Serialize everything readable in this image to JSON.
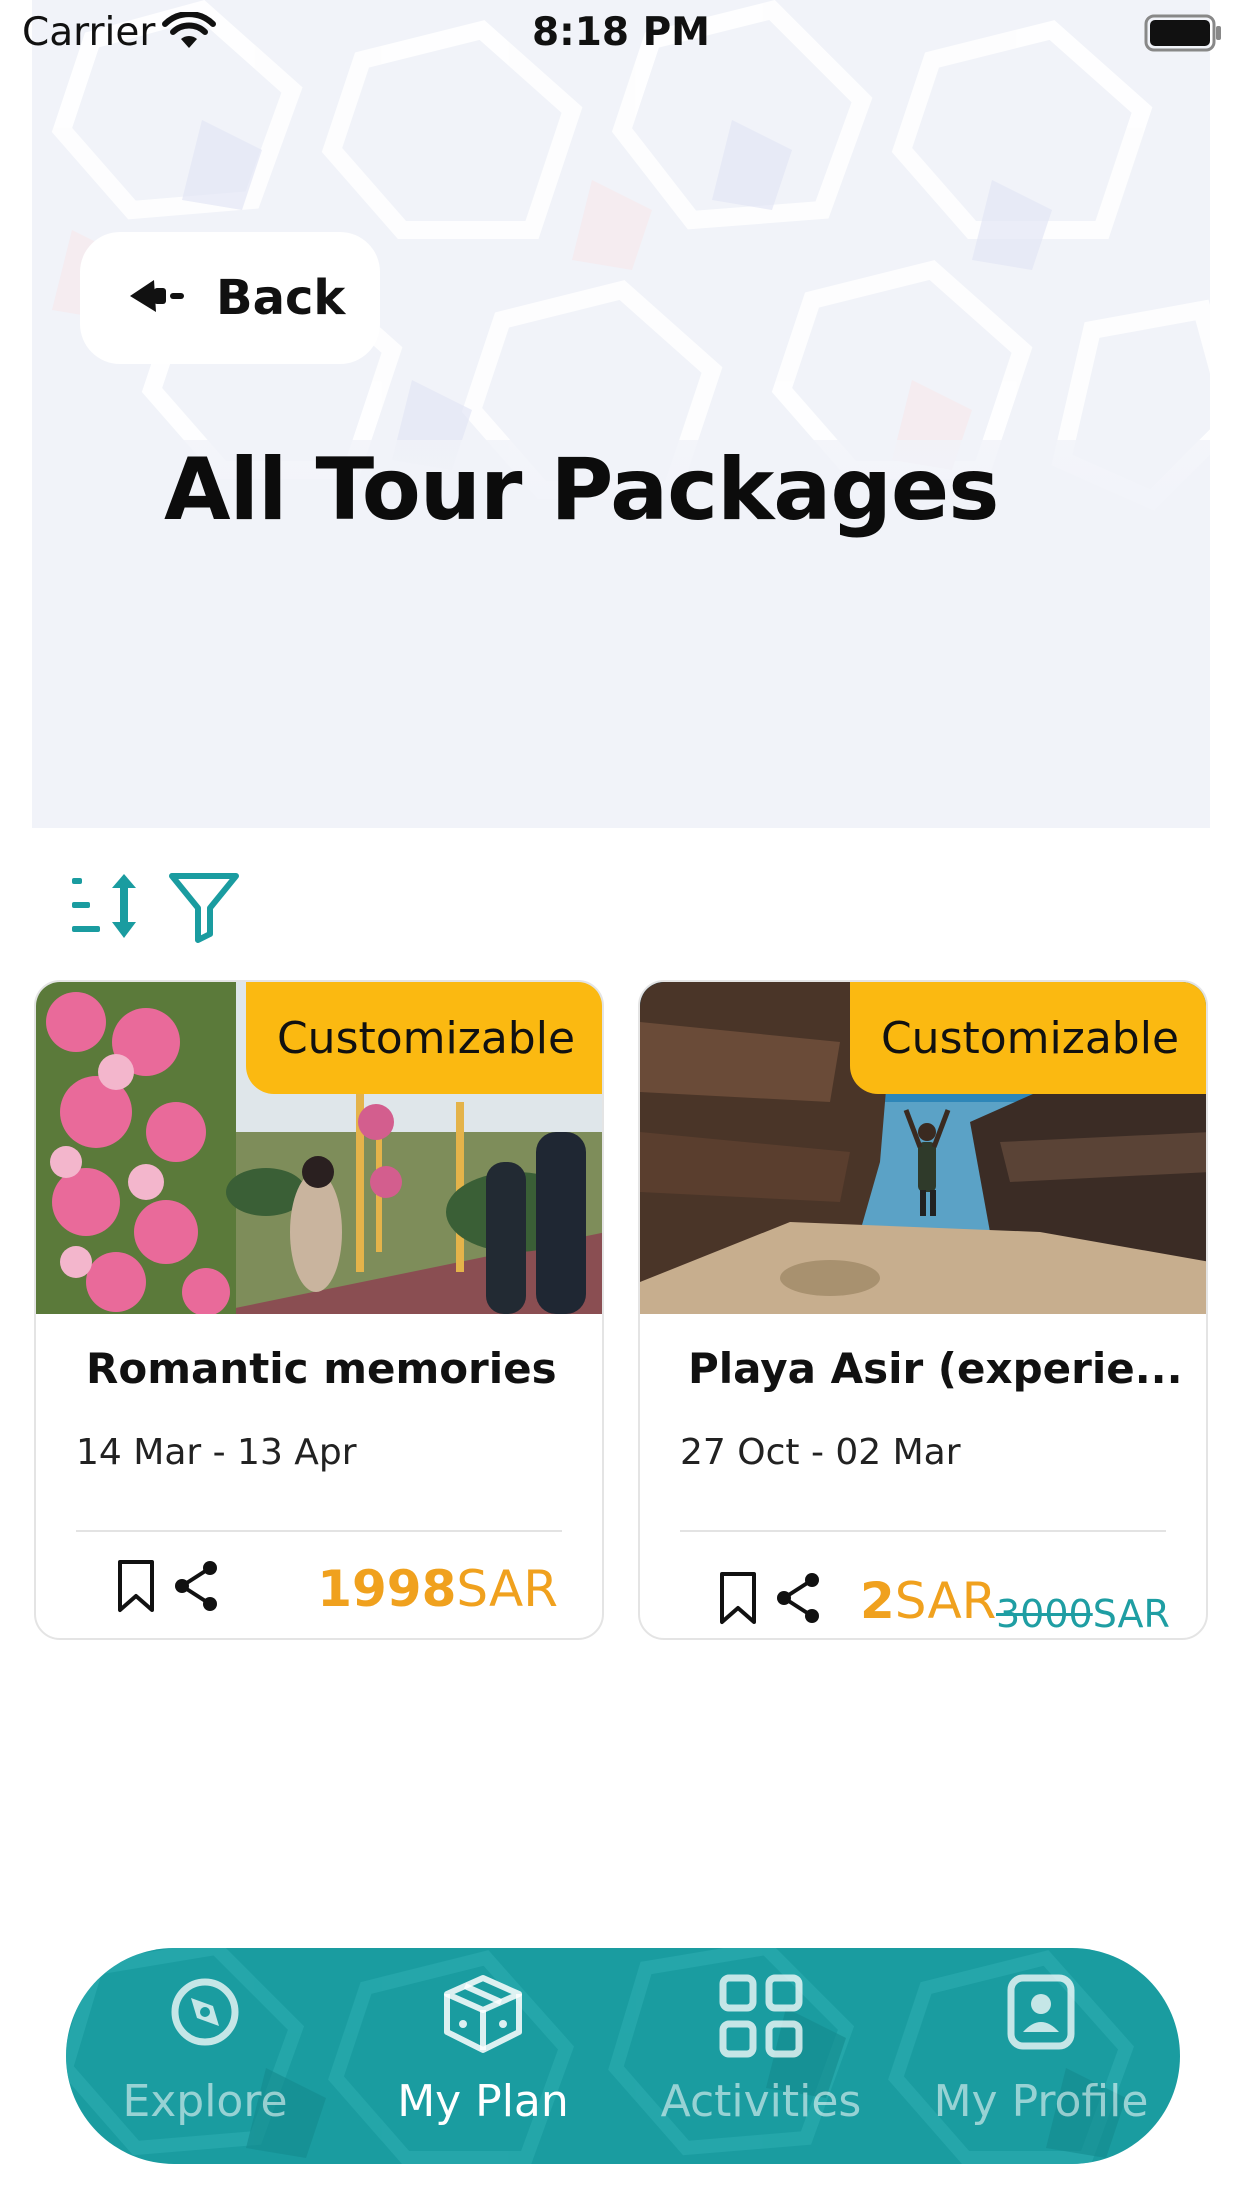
{
  "status_bar": {
    "carrier": "Carrier",
    "time": "8:18 PM"
  },
  "header": {
    "back_label": "Back",
    "title": "All Tour Packages"
  },
  "toolbar": {
    "sort_icon": "sort-icon",
    "filter_icon": "filter-icon"
  },
  "packages": [
    {
      "badge": "Customizable",
      "title": "Romantic memories",
      "dates": "14 Mar - 13 Apr",
      "price": "1998",
      "currency": "SAR"
    },
    {
      "badge": "Customizable",
      "title": "Playa Asir (experie...",
      "dates": "27 Oct - 02 Mar",
      "price": "2",
      "currency": "SAR",
      "old_price": "3000",
      "old_currency": "SAR"
    }
  ],
  "bottom_nav": {
    "items": [
      {
        "label": "Explore",
        "icon": "compass-icon",
        "active": false
      },
      {
        "label": "My Plan",
        "icon": "box-icon",
        "active": true
      },
      {
        "label": "Activities",
        "icon": "grid-icon",
        "active": false
      },
      {
        "label": "My Profile",
        "icon": "profile-icon",
        "active": false
      }
    ]
  },
  "colors": {
    "accent": "#1a9ca0",
    "badge": "#fbb911",
    "price": "#f0a11e",
    "header_bg": "#f1f3f9"
  }
}
